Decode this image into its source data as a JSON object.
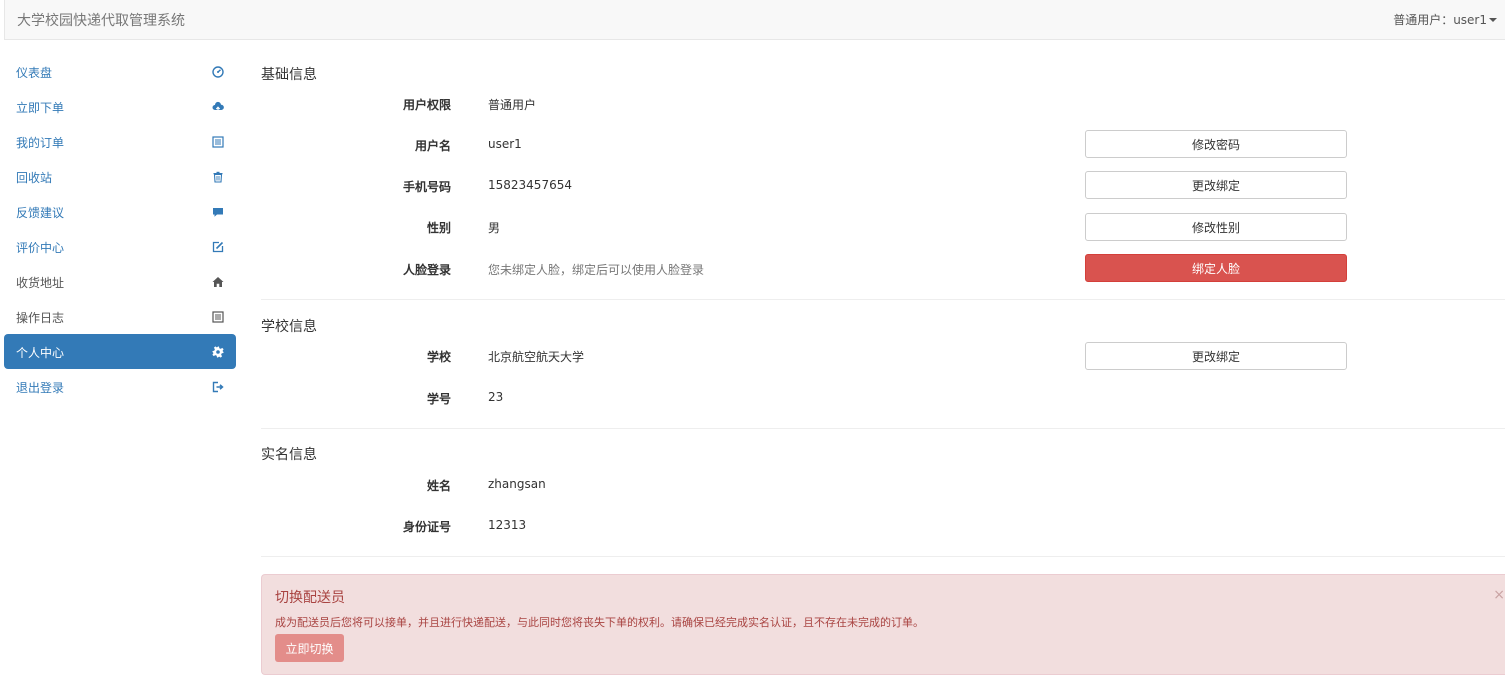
{
  "header": {
    "brand": "大学校园快递代取管理系统",
    "user_menu": "普通用户：user1"
  },
  "sidebar": {
    "items": [
      {
        "label": "仪表盘",
        "icon": "dashboard-icon"
      },
      {
        "label": "立即下单",
        "icon": "cloud-upload-icon"
      },
      {
        "label": "我的订单",
        "icon": "list-icon"
      },
      {
        "label": "回收站",
        "icon": "trash-icon"
      },
      {
        "label": "反馈建议",
        "icon": "comment-icon"
      },
      {
        "label": "评价中心",
        "icon": "edit-icon"
      },
      {
        "label": "收货地址",
        "icon": "home-icon"
      },
      {
        "label": "操作日志",
        "icon": "list-icon"
      },
      {
        "label": "个人中心",
        "icon": "gear-icon",
        "active": true
      },
      {
        "label": "退出登录",
        "icon": "logout-icon"
      }
    ]
  },
  "basic": {
    "title": "基础信息",
    "role_label": "用户权限",
    "role_value": "普通用户",
    "username_label": "用户名",
    "username_value": "user1",
    "change_password_button": "修改密码",
    "phone_label": "手机号码",
    "phone_value": "15823457654",
    "change_phone_button": "更改绑定",
    "gender_label": "性别",
    "gender_value": "男",
    "change_gender_button": "修改性别",
    "face_label": "人脸登录",
    "face_value": "您未绑定人脸，绑定后可以使用人脸登录",
    "bind_face_button": "绑定人脸"
  },
  "school": {
    "title": "学校信息",
    "school_label": "学校",
    "school_value": "北京航空航天大学",
    "change_school_button": "更改绑定",
    "student_id_label": "学号",
    "student_id_value": "23"
  },
  "realname": {
    "title": "实名信息",
    "name_label": "姓名",
    "name_value": "zhangsan",
    "idcard_label": "身份证号",
    "idcard_value": "12313"
  },
  "alert": {
    "title": "切换配送员",
    "text": "成为配送员后您将可以接单，并且进行快递配送，与此同时您将丧失下单的权利。请确保已经完成实名认证，且不存在未完成的订单。",
    "button": "立即切换",
    "close": "×"
  },
  "colors": {
    "primary": "#337ab7",
    "danger": "#d9534f",
    "alert_bg": "#f2dede",
    "alert_text": "#a94442"
  }
}
